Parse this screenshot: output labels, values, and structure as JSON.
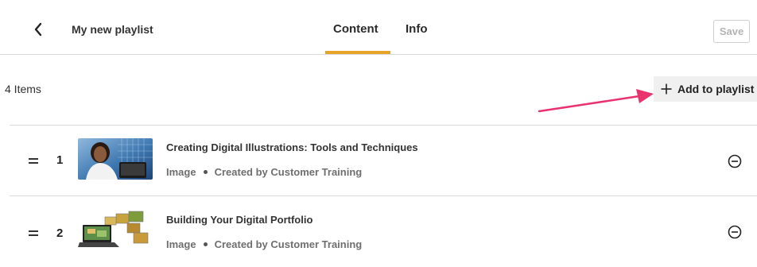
{
  "header": {
    "title": "My new playlist",
    "tabs": [
      {
        "label": "Content",
        "active": true
      },
      {
        "label": "Info",
        "active": false
      }
    ],
    "save_label": "Save"
  },
  "toolbar": {
    "item_count": "4 Items",
    "add_label": "Add to playlist"
  },
  "items": [
    {
      "index": "1",
      "title": "Creating Digital Illustrations: Tools and Techniques",
      "type": "Image",
      "created_by": "Created by Customer Training"
    },
    {
      "index": "2",
      "title": "Building Your Digital Portfolio",
      "type": "Image",
      "created_by": "Created by Customer Training"
    }
  ],
  "colors": {
    "tab_underline": "#e7a42a",
    "annotation_arrow": "#e8336e"
  },
  "icons": {
    "back": "chevron-left-icon",
    "add": "plus-icon",
    "remove": "minus-circle-icon",
    "drag": "drag-handle-icon"
  }
}
